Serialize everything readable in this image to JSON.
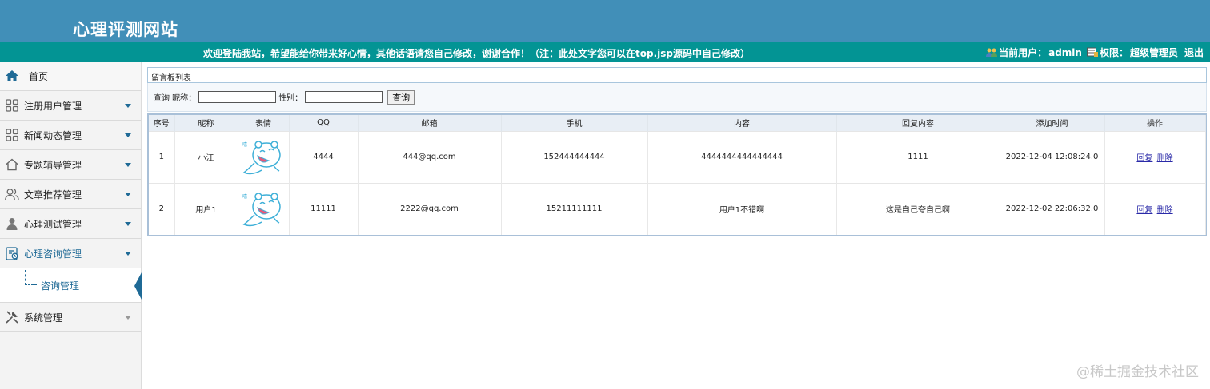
{
  "header": {
    "site_title": "心理评测网站",
    "welcome": "欢迎登陆我站，希望能给你带来好心情，其他话语请您自己修改，谢谢合作！（注：此处文字您可以在top.jsp源码中自己修改）",
    "current_user_label": "当前用户：",
    "current_user": "admin",
    "role_label": "权限：",
    "role": "超级管理员",
    "logout": "退出"
  },
  "sidebar": {
    "home": "首页",
    "items": [
      {
        "label": "注册用户管理",
        "icon": "grid-icon"
      },
      {
        "label": "新闻动态管理",
        "icon": "grid-icon"
      },
      {
        "label": "专题辅导管理",
        "icon": "home-outline-icon"
      },
      {
        "label": "文章推荐管理",
        "icon": "users-icon"
      },
      {
        "label": "心理测试管理",
        "icon": "person-icon"
      },
      {
        "label": "心理咨询管理",
        "icon": "consult-icon"
      }
    ],
    "sub_item": "咨询管理",
    "system": "系统管理"
  },
  "main": {
    "panel_title": "留言板列表",
    "search": {
      "prefix": "查询 昵称：",
      "gender_label": "性别：",
      "button": "查询",
      "nickname_value": "",
      "gender_value": ""
    },
    "columns": [
      "序号",
      "昵称",
      "表情",
      "QQ",
      "邮箱",
      "手机",
      "内容",
      "回复内容",
      "添加时间",
      "操作"
    ],
    "rows": [
      {
        "no": "1",
        "nickname": "小江",
        "qq": "4444",
        "email": "444@qq.com",
        "phone": "152444444444",
        "content": "4444444444444444",
        "reply": "1111",
        "time": "2022-12-04 12:08:24.0",
        "reply_action": "回复",
        "delete_action": "删除"
      },
      {
        "no": "2",
        "nickname": "用户1",
        "qq": "11111",
        "email": "2222@qq.com",
        "phone": "15211111111",
        "content": "用户1不错啊",
        "reply": "这是自己夸自己啊",
        "time": "2022-12-02 22:06:32.0",
        "reply_action": "回复",
        "delete_action": "删除"
      }
    ]
  },
  "watermark": "@稀土掘金技术社区",
  "colors": {
    "header": "#418fb8",
    "subbar": "#039494",
    "accent": "#1f6a96"
  }
}
